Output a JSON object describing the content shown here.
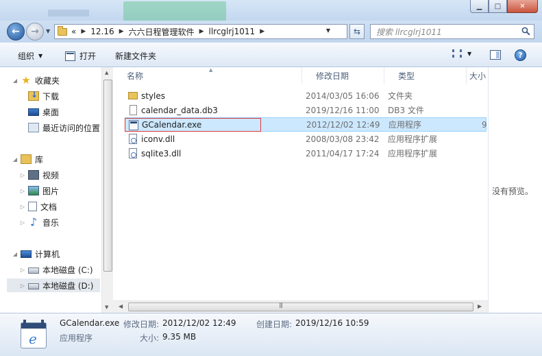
{
  "window": {
    "min_glyph": "▁",
    "max_glyph": "□",
    "close_glyph": "✕"
  },
  "address": {
    "overflow": "«",
    "crumbs": [
      "12.16",
      "六六日程管理软件",
      "llrcglrj1011"
    ],
    "search_placeholder": "搜索 llrcglrj1011"
  },
  "toolbar": {
    "organize": "组织",
    "open": "打开",
    "new_folder": "新建文件夹"
  },
  "nav": {
    "favorites": "收藏夹",
    "downloads": "下载",
    "desktop": "桌面",
    "recent": "最近访问的位置",
    "libraries": "库",
    "videos": "视频",
    "pictures": "图片",
    "documents": "文档",
    "music": "音乐",
    "computer": "计算机",
    "disk_c": "本地磁盘 (C:)",
    "disk_d": "本地磁盘 (D:)"
  },
  "columns": {
    "name": "名称",
    "modified": "修改日期",
    "type": "类型",
    "size": "大小"
  },
  "files": [
    {
      "name": "styles",
      "modified": "2014/03/05 16:06",
      "type": "文件夹",
      "size": "",
      "icon": "folder-icon"
    },
    {
      "name": "calendar_data.db3",
      "modified": "2019/12/16 11:00",
      "type": "DB3 文件",
      "size": "",
      "icon": "file-icon"
    },
    {
      "name": "GCalendar.exe",
      "modified": "2012/12/02 12:49",
      "type": "应用程序",
      "size": "9,",
      "icon": "exe-icon"
    },
    {
      "name": "iconv.dll",
      "modified": "2008/03/08 23:42",
      "type": "应用程序扩展",
      "size": "",
      "icon": "dll-icon"
    },
    {
      "name": "sqlite3.dll",
      "modified": "2011/04/17 17:24",
      "type": "应用程序扩展",
      "size": "",
      "icon": "dll-icon"
    }
  ],
  "preview": {
    "message": "没有预览。"
  },
  "details": {
    "filename": "GCalendar.exe",
    "type": "应用程序",
    "modified_label": "修改日期:",
    "modified_value": "2012/12/02 12:49",
    "created_label": "创建日期:",
    "created_value": "2019/12/16 10:59",
    "size_label": "大小:",
    "size_value": "9.35 MB"
  },
  "colors": {
    "selection": "#cce8ff",
    "highlight_box": "#d93a3a"
  }
}
